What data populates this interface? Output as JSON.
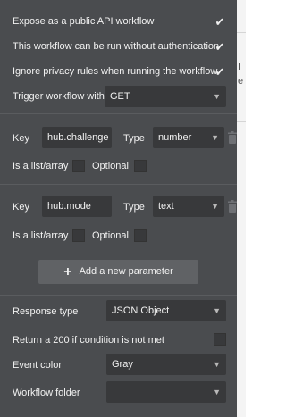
{
  "settings": {
    "expose_public_api": {
      "label": "Expose as a public API workflow",
      "checked": true
    },
    "run_without_auth": {
      "label": "This workflow can be run without authentication",
      "checked": true
    },
    "ignore_privacy": {
      "label": "Ignore privacy rules when running the workflow",
      "checked": true
    },
    "trigger": {
      "label": "Trigger workflow with",
      "value": "GET"
    }
  },
  "parameters": [
    {
      "key_label": "Key",
      "key_value": "hub.challenge",
      "type_label": "Type",
      "type_value": "number",
      "list_label": "Is a list/array",
      "optional_label": "Optional"
    },
    {
      "key_label": "Key",
      "key_value": "hub.mode",
      "type_label": "Type",
      "type_value": "text",
      "list_label": "Is a list/array",
      "optional_label": "Optional"
    }
  ],
  "add_param_label": "Add a new parameter",
  "response": {
    "type_label": "Response type",
    "type_value": "JSON Object",
    "return200_label": "Return a 200 if condition is not met",
    "event_color_label": "Event color",
    "event_color_value": "Gray",
    "folder_label": "Workflow folder",
    "folder_value": ""
  },
  "right_strip": {
    "glyph_1": "I",
    "glyph_2": "e"
  }
}
